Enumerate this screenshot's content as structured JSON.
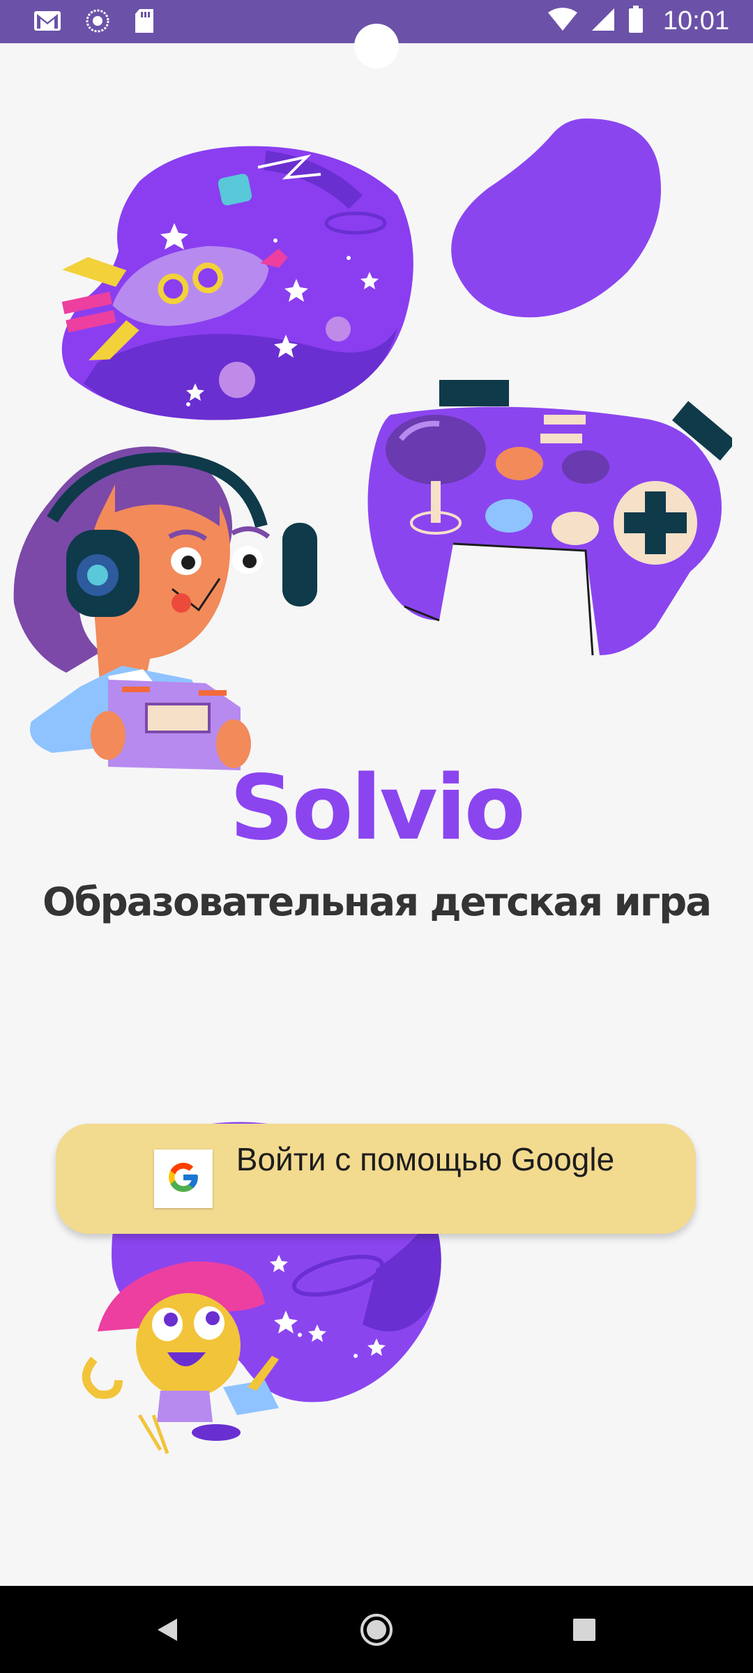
{
  "status_bar": {
    "time": "10:01",
    "left_icons": [
      "gmail-icon",
      "sync-icon",
      "sd-card-icon"
    ],
    "right_icons": [
      "wifi-icon",
      "signal-icon",
      "battery-icon"
    ]
  },
  "app": {
    "title": "Solvio",
    "subtitle": "Образовательная детская игра"
  },
  "login": {
    "google_button_label": "Войти с помощью Google",
    "google_icon": "google-g-icon"
  },
  "nav_bar": {
    "buttons": [
      "back-icon",
      "home-icon",
      "recents-icon"
    ]
  },
  "colors": {
    "accent": "#8b45ef",
    "status_bar": "#6b52a8",
    "button": "#f2da8f",
    "background": "#f6f6f7",
    "subtitle_text": "#343434"
  }
}
